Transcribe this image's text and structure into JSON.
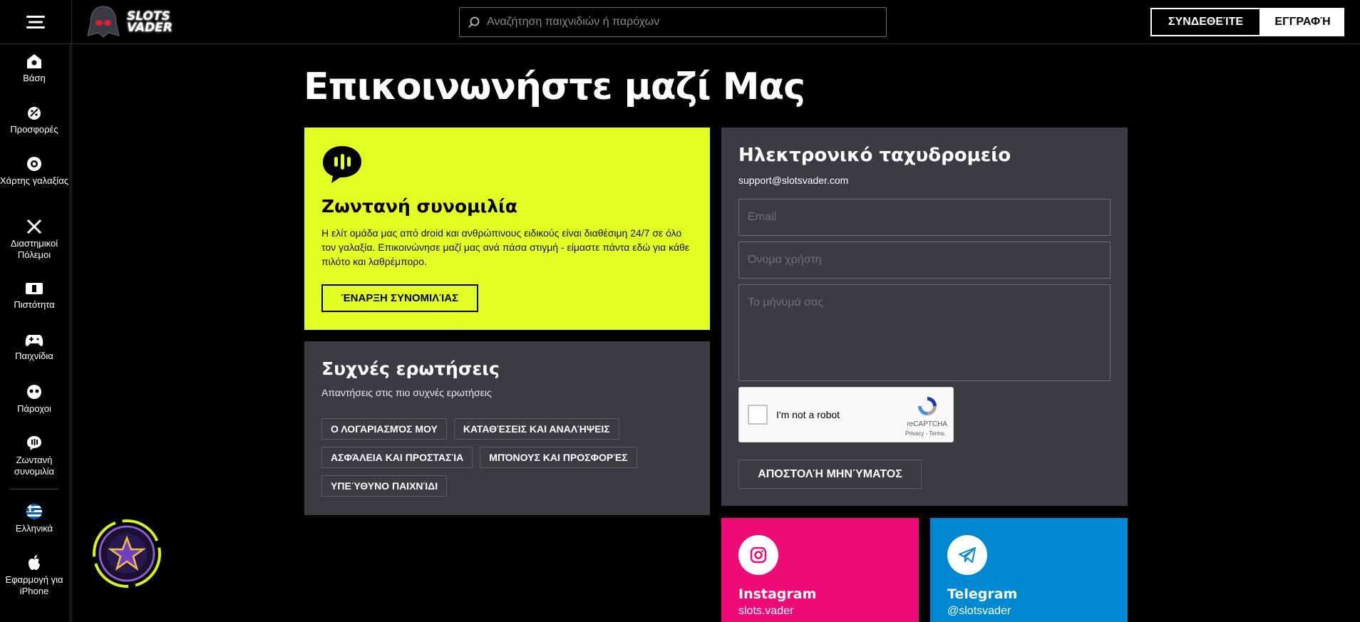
{
  "header": {
    "logo_line1": "SLOTS",
    "logo_line2": "VADER",
    "search_placeholder": "Αναζήτηση παιχνιδιών ή παρόχων",
    "login_label": "ΣΥΝΔΕΘΕΊΤΕ",
    "register_label": "ΕΓΓΡΑΦΉ"
  },
  "sidebar": {
    "items": [
      {
        "label": "Βάση",
        "icon": "home-icon"
      },
      {
        "label": "Προσφορές",
        "icon": "promotions-icon"
      },
      {
        "label": "Χάρτης γαλαξίας",
        "icon": "galaxy-map-icon"
      },
      {
        "label": "Διαστημικοί Πόλεμοι",
        "icon": "space-wars-icon"
      },
      {
        "label": "Πιστότητα",
        "icon": "loyalty-icon"
      },
      {
        "label": "Παιχνίδια",
        "icon": "gamepad-icon"
      },
      {
        "label": "Πάροχοι",
        "icon": "providers-icon"
      },
      {
        "label": "Ζωντανή συνομιλία",
        "icon": "live-chat-icon"
      },
      {
        "label": "Ελληνικά",
        "icon": "greek-flag-icon"
      },
      {
        "label": "Εφαρμογή για iPhone",
        "icon": "apple-icon"
      }
    ]
  },
  "main": {
    "title": "Επικοινωνήστε μαζί Μας",
    "chat": {
      "title": "Ζωντανή συνομιλία",
      "description": "Η ελίτ ομάδα μας από droid και ανθρώπινους ειδικούς είναι διαθέσιμη 24/7 σε όλο τον γαλαξία. Επικοινώνησε μαζί μας ανά πάσα στιγμή - είμαστε πάντα εδώ για κάθε πιλότο και λαθρέμπορο.",
      "button_label": "ΈΝΑΡΞΗ ΣΥΝΟΜΙΛΊΑΣ"
    },
    "faq": {
      "title": "Συχνές ερωτήσεις",
      "subtitle": "Απαντήσεις στις πιο συχνές ερωτήσεις",
      "tags": [
        "Ο ΛΟΓΑΡΙΑΣΜΌΣ ΜΟΥ",
        "ΚΑΤΑΘΈΣΕΙΣ ΚΑΙ ΑΝΑΛΉΨΕΙΣ",
        "ΑΣΦΆΛΕΙΑ ΚΑΙ ΠΡΟΣΤΑΣΊΑ",
        "ΜΠΌΝΟΥΣ ΚΑΙ ΠΡΟΣΦΟΡΈΣ",
        "ΥΠΕΎΘΥΝΟ ΠΑΙΧΝΊΔΙ"
      ]
    },
    "email": {
      "title": "Ηλεκτρονικό ταχυδρομείο",
      "address": "support@slotsvader.com",
      "email_placeholder": "Email",
      "username_placeholder": "Όνομα χρήστη",
      "message_placeholder": "Το μήνυμά σας",
      "captcha_label": "I'm not a robot",
      "captcha_brand": "reCAPTCHA",
      "captcha_links": "Privacy - Terms",
      "send_label": "ΑΠΟΣΤΟΛΉ ΜΗΝΎΜΑΤΟΣ"
    },
    "socials": [
      {
        "name": "Instagram",
        "handle": "slots.vader",
        "color": "#ee0a77"
      },
      {
        "name": "Telegram",
        "handle": "@slotsvader",
        "color": "#0088d0"
      }
    ]
  },
  "colors": {
    "accent": "#e2ff25",
    "card": "#3b3b42",
    "background": "#000000"
  }
}
